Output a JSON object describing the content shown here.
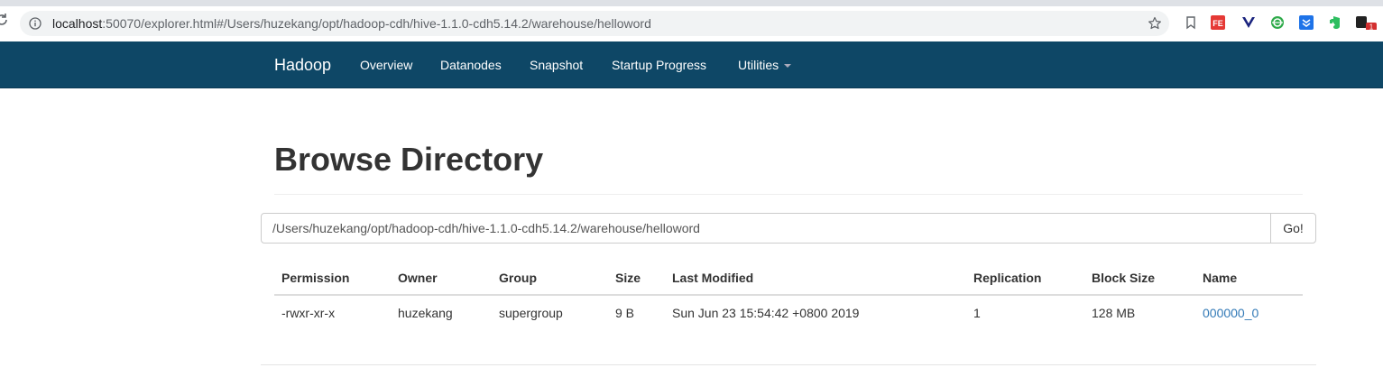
{
  "browser": {
    "url_host": "localhost",
    "url_rest": ":50070/explorer.html#/Users/huzekang/opt/hadoop-cdh/hive-1.1.0-cdh5.14.2/warehouse/helloword",
    "extension_badge": "1",
    "extension_label": "FE"
  },
  "navbar": {
    "brand": "Hadoop",
    "items": [
      "Overview",
      "Datanodes",
      "Snapshot",
      "Startup Progress",
      "Utilities"
    ]
  },
  "page": {
    "title": "Browse Directory",
    "path_value": "/Users/huzekang/opt/hadoop-cdh/hive-1.1.0-cdh5.14.2/warehouse/helloword",
    "go_label": "Go!"
  },
  "table": {
    "headers": [
      "Permission",
      "Owner",
      "Group",
      "Size",
      "Last Modified",
      "Replication",
      "Block Size",
      "Name"
    ],
    "rows": [
      [
        "-rwxr-xr-x",
        "huzekang",
        "supergroup",
        "9 B",
        "Sun Jun 23 15:54:42 +0800 2019",
        "1",
        "128 MB",
        "000000_0"
      ]
    ]
  },
  "colors": {
    "navbar": "#0e4766",
    "link": "#337ab7"
  }
}
